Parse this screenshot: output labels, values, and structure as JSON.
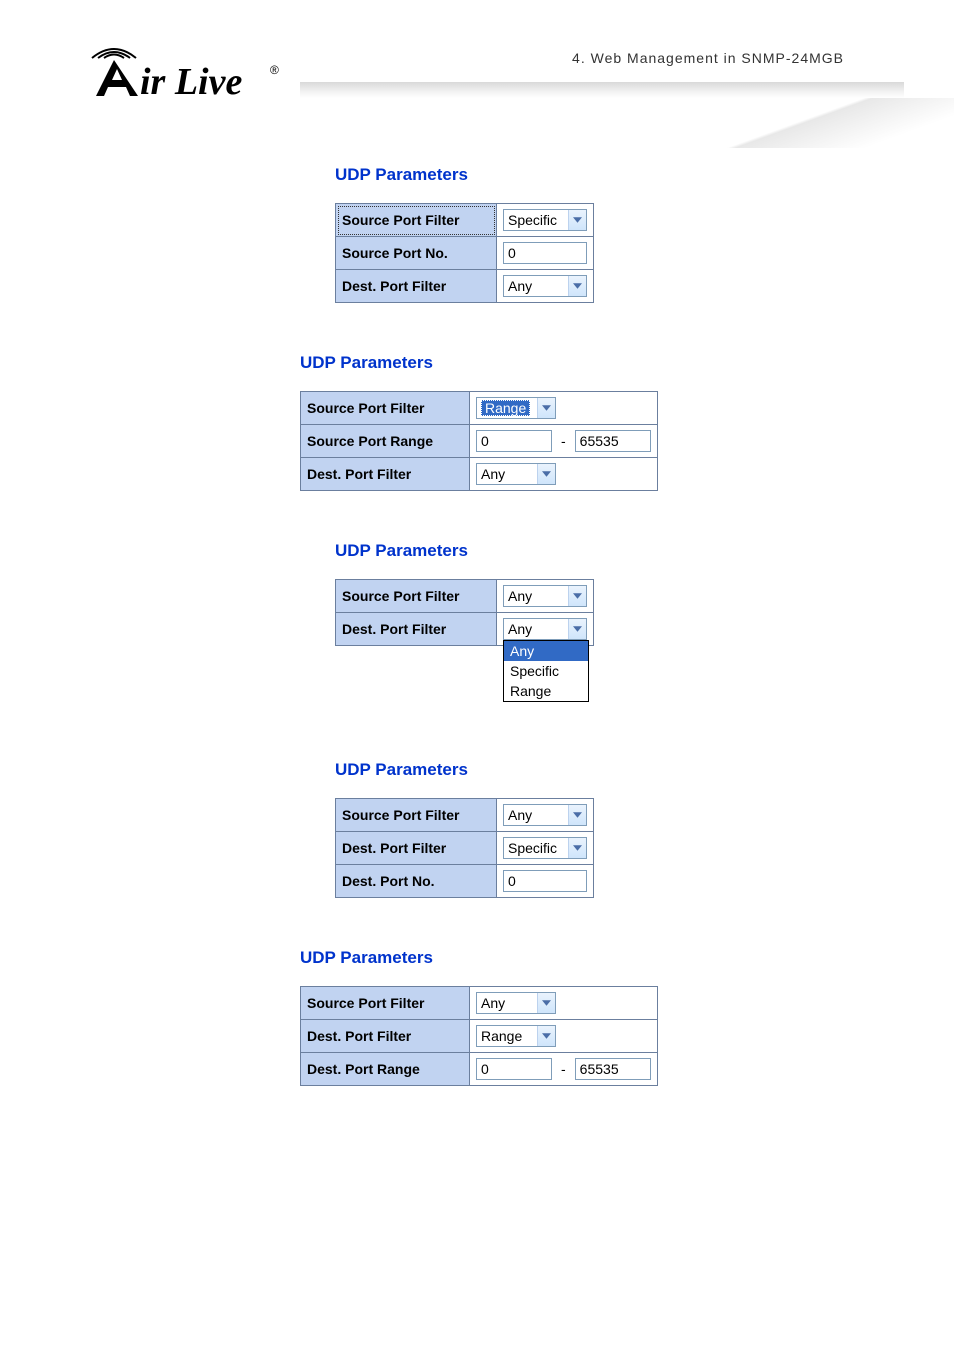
{
  "header": {
    "chapter": "4.  Web Management  in  SNMP-24MGB",
    "brand": "Air Live"
  },
  "labels": {
    "section": "UDP Parameters",
    "source_port_filter": "Source Port Filter",
    "source_port_no": "Source Port No.",
    "source_port_range": "Source Port Range",
    "dest_port_filter": "Dest. Port Filter",
    "dest_port_no": "Dest. Port No.",
    "dest_port_range": "Dest. Port Range",
    "range_sep": "-"
  },
  "options": {
    "any": "Any",
    "specific": "Specific",
    "range": "Range"
  },
  "values": {
    "zero": "0",
    "max": "65535"
  },
  "panel1": {
    "src_filter": "Specific",
    "src_no": "0",
    "dst_filter": "Any"
  },
  "panel2": {
    "src_filter": "Range",
    "src_lo": "0",
    "src_hi": "65535",
    "dst_filter": "Any"
  },
  "panel3": {
    "src_filter": "Any",
    "dst_filter": "Any",
    "dd": {
      "o1": "Any",
      "o2": "Specific",
      "o3": "Range"
    }
  },
  "panel4": {
    "src_filter": "Any",
    "dst_filter": "Specific",
    "dst_no": "0"
  },
  "panel5": {
    "src_filter": "Any",
    "dst_filter": "Range",
    "dst_lo": "0",
    "dst_hi": "65535"
  }
}
